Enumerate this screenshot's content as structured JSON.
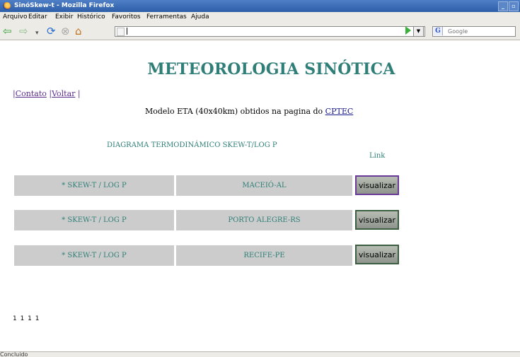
{
  "window": {
    "title": "SinóSkew-t - Mozilla Firefox",
    "controls": [
      "_",
      "▫",
      "✕"
    ]
  },
  "menu": [
    "Arquivo",
    "Editar",
    "Exibir",
    "Histórico",
    "Favoritos",
    "Ferramentas",
    "Ajuda"
  ],
  "toolbar": {
    "search_placeholder": "Google",
    "search_engine": "G"
  },
  "page": {
    "title": "METEOROLOGIA SINÓTICA",
    "nav_links": [
      "Contato",
      "Voltar"
    ],
    "subtitle_text": "Modelo ETA (40x40km) obtidos na pagina do",
    "subtitle_link": "CPTEC",
    "diagram_heading": "DIAGRAMA TERMODINÁMICO SKEW-T/LOG P",
    "link_heading": "Link",
    "rows": [
      {
        "type": "* SKEW-T / LOG P",
        "location": "MACEIÓ-AL",
        "button": "visualizar"
      },
      {
        "type": "* SKEW-T / LOG P",
        "location": "PORTO ALEGRE-RS",
        "button": "visualizar"
      },
      {
        "type": "* SKEW-T / LOG P",
        "location": "RECIFE-PE",
        "button": "visualizar"
      }
    ],
    "footer_counters": "1 1 1 1"
  },
  "status": {
    "text": "Concluído"
  },
  "colors": {
    "accent_teal": "#2f7f78",
    "link_purple": "#5b2e8c",
    "row_gray": "#cccccc",
    "titlebar_blue": "#2d5ea8"
  }
}
